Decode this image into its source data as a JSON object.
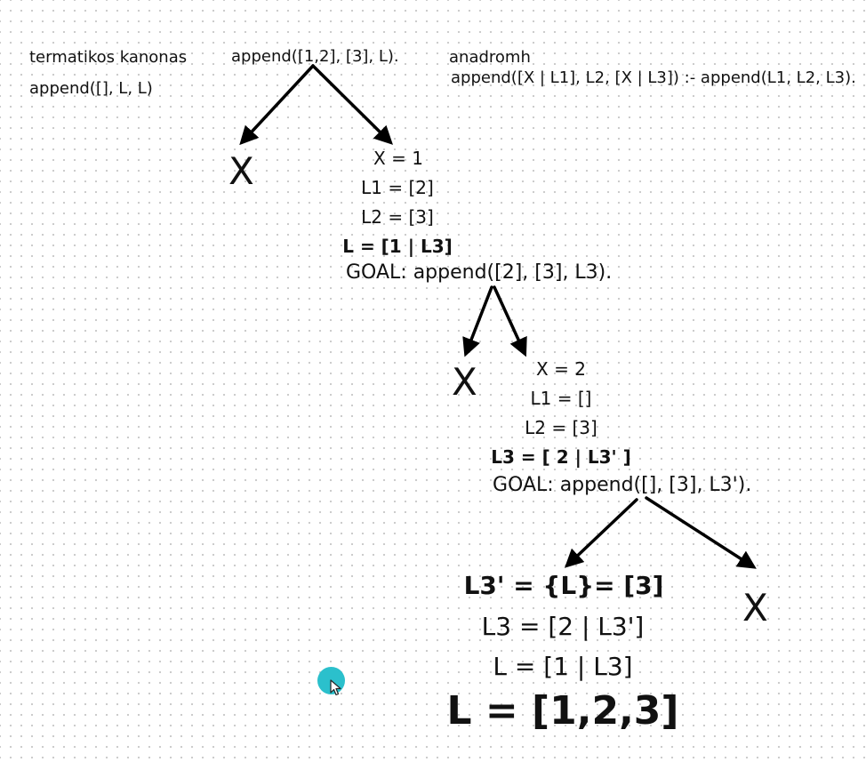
{
  "rules": {
    "fact_heading": "termatikos kanonas",
    "fact": "append([], L, L)",
    "recursive_heading": "anadromh",
    "recursive": "append([X | L1], L2, [X | L3]) :- append(L1, L2, L3)."
  },
  "root_query": "append([1,2], [3], L).",
  "level1": {
    "fail_mark": "X",
    "bindings": [
      "X = 1",
      "L1 = [2]",
      "L2 = [3]"
    ],
    "result_binding": "L = [1 | L3]",
    "goal": "GOAL:  append([2], [3], L3)."
  },
  "level2": {
    "fail_mark": "X",
    "bindings": [
      "X = 2",
      "L1 = []",
      "L2 = [3]"
    ],
    "result_binding": "L3 = [ 2 | L3' ]",
    "goal": "GOAL:  append([], [3], L3')."
  },
  "level3": {
    "fail_mark": "X",
    "base_binding": "L3' = {L}= [3]",
    "back_substitution": [
      "L3 = [2 | L3']",
      "L = [1 | L3]"
    ],
    "final_answer": "L = [1,2,3]"
  },
  "colors": {
    "cursor": "#2bc0cc",
    "arrow": "#000000",
    "grid_dot": "#c9c9c9"
  },
  "icons": {
    "cursor": "mouse-pointer-icon"
  }
}
